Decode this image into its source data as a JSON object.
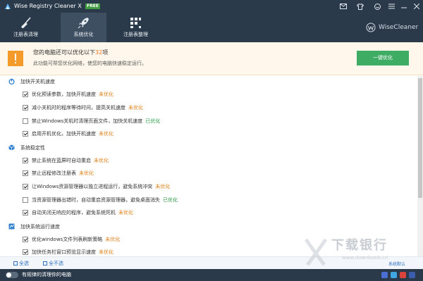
{
  "window": {
    "title": "Wise Registry Cleaner X",
    "badge": "FREE"
  },
  "nav": {
    "tabs": [
      {
        "label": "注册表清理",
        "icon": "broom-icon"
      },
      {
        "label": "系统优化",
        "icon": "rocket-icon"
      },
      {
        "label": "注册表整理",
        "icon": "defrag-blocks-icon"
      }
    ],
    "active_tab": 1
  },
  "brand": {
    "name": "WiseCleaner"
  },
  "banner": {
    "title_prefix": "您的电脑还可以优化以下",
    "count": "32",
    "title_suffix": "项",
    "subtitle": "此功能可帮您优化网络，使您的电脑快速稳定运行。",
    "button": "一键优化"
  },
  "sections": [
    {
      "label": "加快开关机速度",
      "icon": "power-icon",
      "items": [
        {
          "label": "优化预读参数，加快开机速度",
          "status": "未优化",
          "checked": true,
          "optimized": false
        },
        {
          "label": "减小关机时的程序等待时间，提高关机速度",
          "status": "未优化",
          "checked": true,
          "optimized": false
        },
        {
          "label": "禁止Windows关机时清理页面文件，加快关机速度",
          "status": "已优化",
          "checked": false,
          "optimized": true
        },
        {
          "label": "启用开机优化，加快开机速度",
          "status": "未优化",
          "checked": true,
          "optimized": false
        }
      ]
    },
    {
      "label": "系统稳定性",
      "icon": "cube-icon",
      "items": [
        {
          "label": "禁止系统在蓝屏时自动重启",
          "status": "未优化",
          "checked": true,
          "optimized": false
        },
        {
          "label": "禁止远程修改注册表",
          "status": "未优化",
          "checked": true,
          "optimized": false
        },
        {
          "label": "让Windows资源管理器以独立进程运行，避免系统冲突",
          "status": "未优化",
          "checked": true,
          "optimized": false
        },
        {
          "label": "当资源管理器出错时，自动重启资源管理器，避免桌面消失",
          "status": "已优化",
          "checked": false,
          "optimized": true
        },
        {
          "label": "自动关闭无响应的程序，避免系统死机",
          "status": "未优化",
          "checked": true,
          "optimized": false
        }
      ]
    },
    {
      "label": "加快系统运行速度",
      "icon": "speed-icon",
      "items": [
        {
          "label": "优化windows文件列表刷新策略",
          "status": "未优化",
          "checked": true,
          "optimized": false
        },
        {
          "label": "加快任务栏窗口预览显示速度",
          "status": "未优化",
          "checked": true,
          "optimized": false
        }
      ]
    }
  ],
  "footer": {
    "select_all": "全选",
    "select_none": "全不选",
    "restore_default": "系统默认"
  },
  "statusbar": {
    "schedule_text": "有规律的清理你的电脑",
    "toggle_on": false
  },
  "watermark": {
    "text": "下载银行",
    "url": "www.downbank.cn"
  },
  "colors": {
    "topbar": "#2b3a4a",
    "active_tab": "#3e4f61",
    "pending": "#e07f17",
    "done": "#2c9a47",
    "button": "#3fac64",
    "banner_bg": "#fff7ec"
  }
}
